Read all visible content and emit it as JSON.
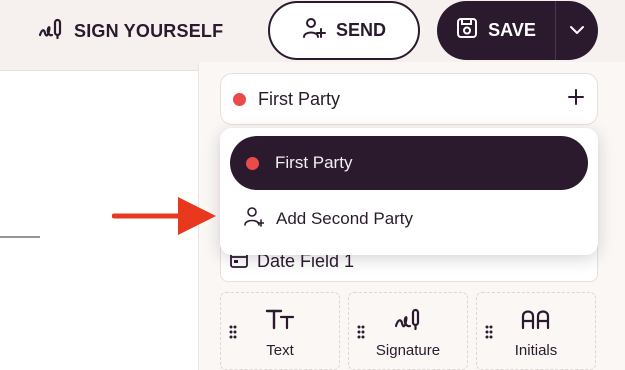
{
  "toolbar": {
    "sign_yourself_label": "SIGN YOURSELF",
    "send_label": "SEND",
    "save_label": "SAVE"
  },
  "sidebar": {
    "party_select": {
      "selected_label": "First Party",
      "dot_color": "#ea4a4a"
    },
    "dropdown": {
      "items": [
        {
          "label": "First Party",
          "selected": true
        },
        {
          "label": "Add Second Party",
          "selected": false
        }
      ]
    },
    "date_field_label": "Date Field 1",
    "field_tiles": [
      {
        "label": "Text",
        "icon": "text-type-icon",
        "glyph": "Tт"
      },
      {
        "label": "Signature",
        "icon": "signature-icon",
        "glyph": ""
      },
      {
        "label": "Initials",
        "icon": "initials-icon",
        "glyph": "AA"
      }
    ]
  },
  "colors": {
    "primary": "#2b1a2e",
    "party_dot": "#ea4a4a",
    "annotation_arrow": "#e8391f",
    "background": "#f6f1ee"
  }
}
